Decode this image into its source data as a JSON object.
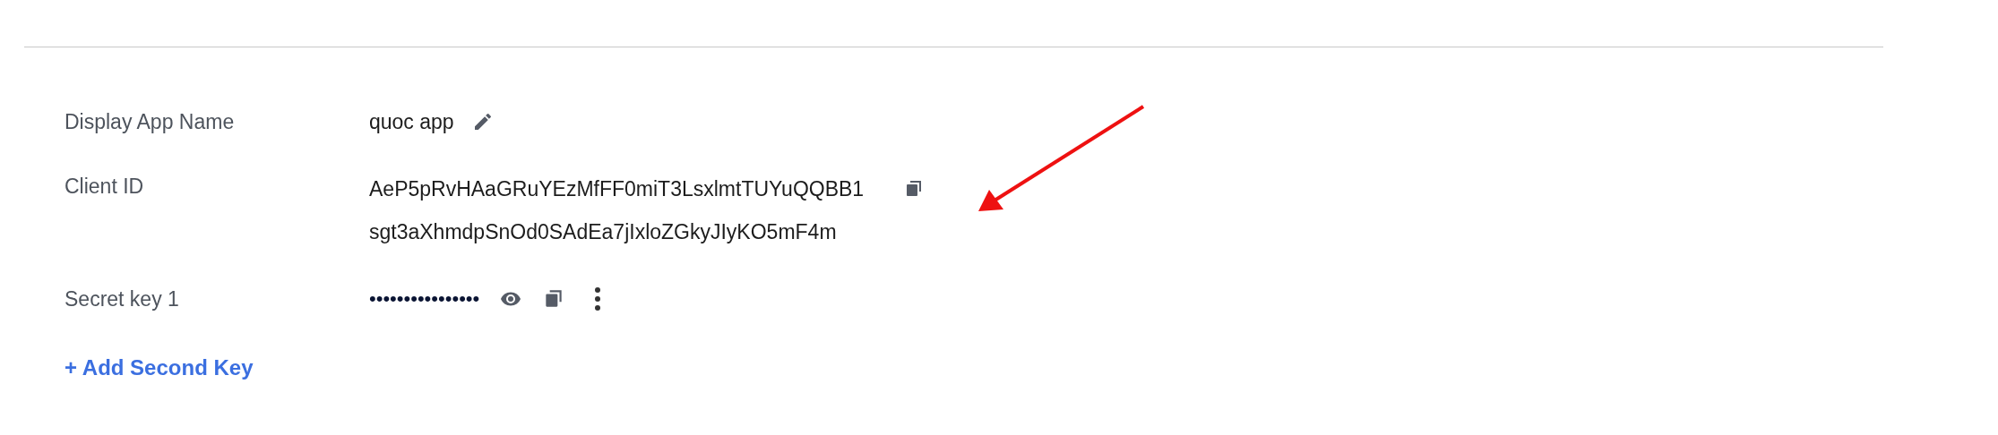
{
  "fields": [
    {
      "kind": "editable",
      "label": "Display App Name",
      "value": "quoc app"
    },
    {
      "kind": "copyable",
      "label": "Client ID",
      "lines": [
        "AeP5pRvHAaGRuYEzMfFF0miT3LsxlmtTUYuQQBB1",
        "sgt3aXhmdpSnOd0SAdEa7jIxloZGkyJIyKO5mF4m"
      ]
    },
    {
      "kind": "secret",
      "label": "Secret key 1",
      "value": "••••••••••••••••"
    }
  ],
  "add_link": "+ Add Second Key"
}
